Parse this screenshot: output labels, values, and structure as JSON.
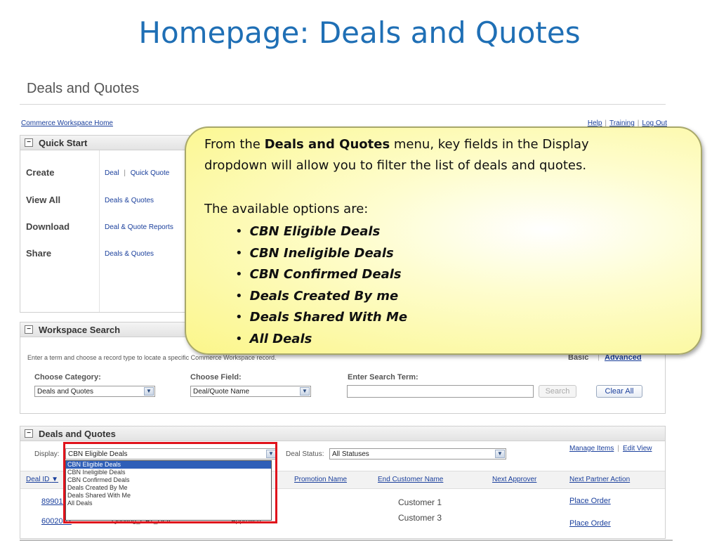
{
  "slide_title": "Homepage: Deals and Quotes",
  "app": {
    "title": "Deals and Quotes",
    "home_link": "Commerce Workspace Home",
    "top_links": [
      "Help",
      "Training",
      "Log Out"
    ]
  },
  "quick_start": {
    "header": "Quick Start",
    "rows": [
      {
        "label": "Create",
        "links": [
          "Deal",
          "Quick Quote"
        ]
      },
      {
        "label": "View All",
        "links": [
          "Deals & Quotes"
        ]
      },
      {
        "label": "Download",
        "links": [
          "Deal & Quote Reports"
        ]
      },
      {
        "label": "Share",
        "links": [
          "Deals & Quotes"
        ]
      }
    ]
  },
  "workspace_search": {
    "header": "Workspace Search",
    "instructions": "Enter a term and choose a record type to locate a specific Commerce Workspace record.",
    "mode_basic": "Basic",
    "mode_advanced": "Advanced",
    "category_label": "Choose Category:",
    "category_value": "Deals and Quotes",
    "field_label": "Choose Field:",
    "field_value": "Deal/Quote Name",
    "term_label": "Enter Search Term:",
    "term_value": "",
    "search_button": "Search",
    "clear_button": "Clear All"
  },
  "deals_panel": {
    "header": "Deals and Quotes",
    "display_label": "Display:",
    "display_value": "CBN Eligible Deals",
    "display_options": [
      "CBN Eligible Deals",
      "CBN Ineligible Deals",
      "CBN Confirmed Deals",
      "Deals Created By Me",
      "Deals Shared With Me",
      "All Deals"
    ],
    "status_label": "Deal Status:",
    "status_value": "All Statuses",
    "manage_items": "Manage Items",
    "edit_view": "Edit View",
    "columns": [
      "Deal ID",
      "Promotion Name",
      "End Customer Name",
      "Next Approver",
      "Next Partner Action"
    ],
    "rows": [
      {
        "deal_id": "899019",
        "customer": "Customer 1",
        "action": "Place Order",
        "name": "",
        "status": ""
      },
      {
        "deal_id": "6002002",
        "customer": "Customer 3",
        "action": "Place Order",
        "name": "Quoting_CAT_Dea...",
        "status": "Approved"
      }
    ]
  },
  "callout": {
    "line1_pre": "From the ",
    "line1_bold": "Deals and Quotes",
    "line1_post": " menu, key fields in the Display",
    "line2": "dropdown will allow you to filter the list of deals and quotes.",
    "line3": "The available options are:",
    "options": [
      "CBN Eligible Deals",
      "CBN Ineligible Deals",
      "CBN Confirmed Deals",
      "Deals Created By me",
      "Deals Shared With Me",
      "All Deals"
    ]
  },
  "colors": {
    "title_blue": "#1f6fb5",
    "highlight_red": "#e0121b",
    "callout_yellow": "#fbf68a",
    "selection_blue": "#2f5fb8"
  }
}
